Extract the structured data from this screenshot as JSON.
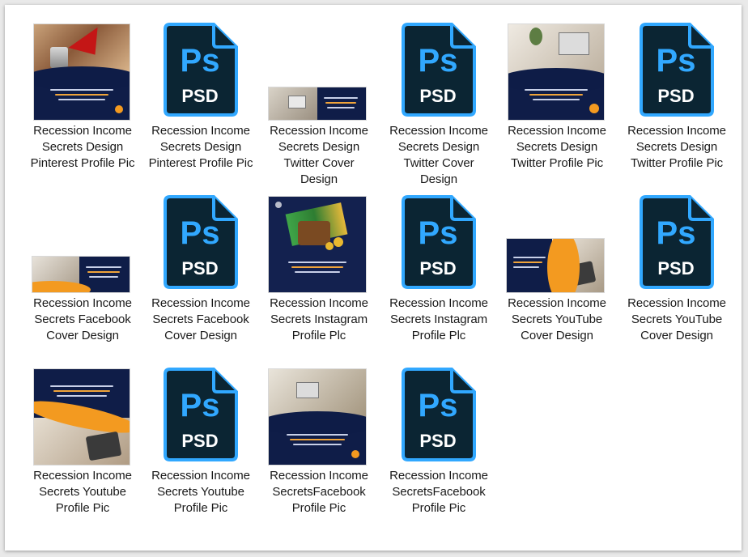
{
  "icons": {
    "psd": "photoshop-psd-icon",
    "ps_glyph": "Ps",
    "psd_text": "PSD"
  },
  "colors": {
    "ps_bg": "#0b2533",
    "ps_border": "#31a8ff",
    "ps_text": "#31a8ff",
    "navy": "#0e1c47",
    "orange": "#f39a20"
  },
  "files": [
    {
      "label": "Recession Income Secrets Design Pinterest Profile Pic",
      "kind": "image"
    },
    {
      "label": "Recession Income Secrets Design Pinterest Profile Pic",
      "kind": "psd"
    },
    {
      "label": "Recession Income Secrets Design Twitter Cover Design",
      "kind": "image"
    },
    {
      "label": "Recession Income Secrets Design Twitter Cover Design",
      "kind": "psd"
    },
    {
      "label": "Recession Income Secrets Design Twitter Profile Pic",
      "kind": "image"
    },
    {
      "label": "Recession Income Secrets Design Twitter Profile Pic",
      "kind": "psd"
    },
    {
      "label": "Recession Income Secrets Facebook Cover Design",
      "kind": "image"
    },
    {
      "label": "Recession Income Secrets Facebook Cover Design",
      "kind": "psd"
    },
    {
      "label": "Recession Income Secrets Instagram Profile Plc",
      "kind": "image"
    },
    {
      "label": "Recession Income Secrets Instagram Profile Plc",
      "kind": "psd"
    },
    {
      "label": "Recession Income Secrets YouTube Cover Design",
      "kind": "image"
    },
    {
      "label": "Recession Income Secrets YouTube Cover Design",
      "kind": "psd"
    },
    {
      "label": "Recession Income Secrets Youtube Profile Pic",
      "kind": "image"
    },
    {
      "label": "Recession Income Secrets Youtube Profile Pic",
      "kind": "psd"
    },
    {
      "label": "Recession Income SecretsFacebook Profile Pic",
      "kind": "image"
    },
    {
      "label": "Recession Income SecretsFacebook Profile Pic",
      "kind": "psd"
    }
  ]
}
